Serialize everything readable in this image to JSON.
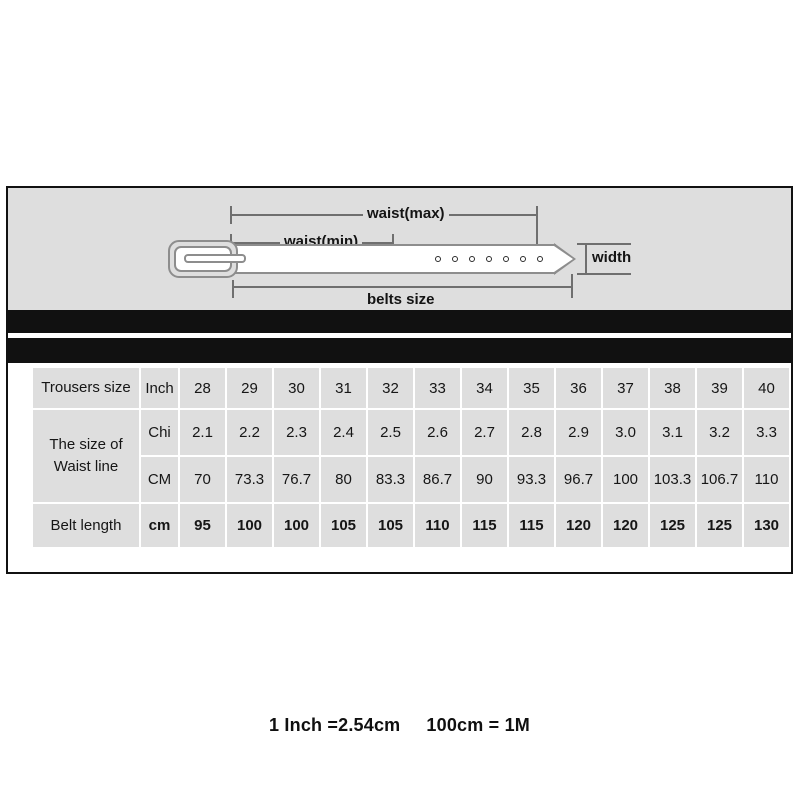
{
  "diagram": {
    "title": "belt-measurement-diagram",
    "labels": {
      "waist_max": "waist(max)",
      "waist_min": "waist(min)",
      "belts_size": "belts size",
      "width": "width"
    },
    "hole_count": 7
  },
  "table": {
    "rows": [
      {
        "label": "Trousers size",
        "unit": "Inch",
        "values": [
          "28",
          "29",
          "30",
          "31",
          "32",
          "33",
          "34",
          "35",
          "36",
          "37",
          "38",
          "39",
          "40"
        ],
        "highlight": false
      },
      {
        "label": "The size of",
        "label2": "Waist line",
        "unit": "Chi",
        "values": [
          "2.1",
          "2.2",
          "2.3",
          "2.4",
          "2.5",
          "2.6",
          "2.7",
          "2.8",
          "2.9",
          "3.0",
          "3.1",
          "3.2",
          "3.3"
        ],
        "highlight": false
      },
      {
        "label": "",
        "unit": "CM",
        "values": [
          "70",
          "73.3",
          "76.7",
          "80",
          "83.3",
          "86.7",
          "90",
          "93.3",
          "96.7",
          "100",
          "103.3",
          "106.7",
          "110"
        ],
        "highlight": false
      },
      {
        "label": "Belt length",
        "unit": "cm",
        "values": [
          "95",
          "100",
          "100",
          "105",
          "105",
          "110",
          "115",
          "115",
          "120",
          "120",
          "125",
          "125",
          "130"
        ],
        "highlight": true
      }
    ],
    "merged_label": "The size of\nWaist line"
  },
  "footnote": {
    "part1": "1 Inch =2.54cm",
    "part2": "100cm = 1M"
  },
  "colors": {
    "accent_red": "#e2182b",
    "cell_bg": "#dedede",
    "panel_bg": "#ffffff",
    "bar_black": "#111111",
    "line_grey": "#6f6f6f"
  }
}
